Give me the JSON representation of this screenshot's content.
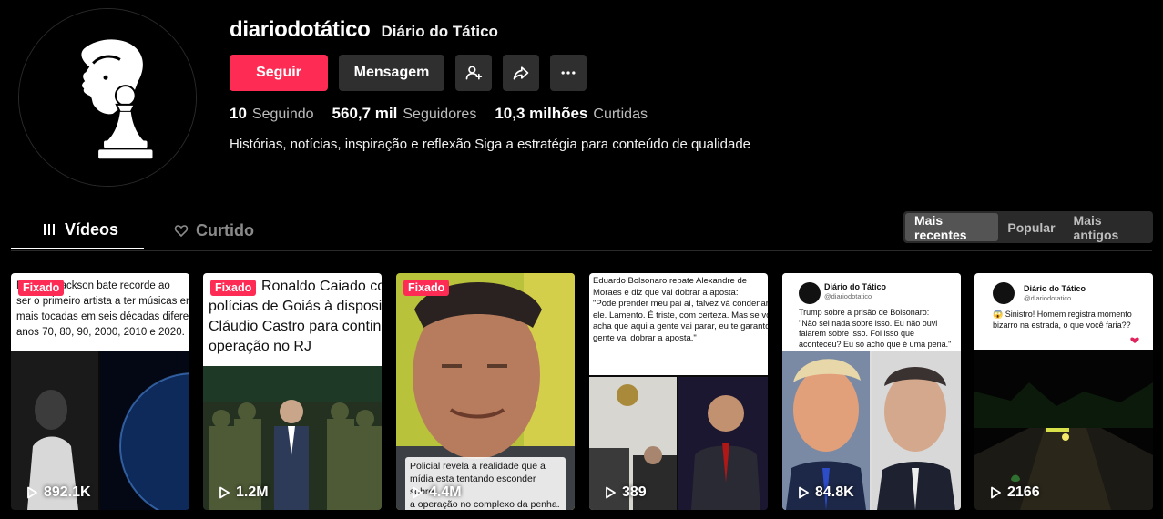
{
  "profile": {
    "username": "diariodotático",
    "nickname": "Diário do Tático",
    "bio": "Histórias, notícias, inspiração e reflexão Siga a estratégia para conteúdo de qualidade"
  },
  "actions": {
    "follow_label": "Seguir",
    "message_label": "Mensagem",
    "icons": [
      "add-friend-icon",
      "share-icon",
      "more-icon"
    ]
  },
  "stats": {
    "following": {
      "value": "10",
      "label": "Seguindo"
    },
    "followers": {
      "value": "560,7 mil",
      "label": "Seguidores"
    },
    "likes": {
      "value": "10,3 milhões",
      "label": "Curtidas"
    }
  },
  "tabs": {
    "videos": "Vídeos",
    "liked": "Curtido"
  },
  "sort": {
    "options": [
      "Mais recentes",
      "Popular",
      "Mais antigos"
    ],
    "selected": "Mais recentes"
  },
  "videos": [
    {
      "pinned": "Fixado",
      "views": "892.1K",
      "headline": [
        "Michael Jackson bate recorde ao",
        "ser o primeiro artista a ter músicas entre as",
        "mais tocadas em seis décadas diferentes: nos",
        "anos 70, 80, 90, 2000, 2010 e 2020."
      ]
    },
    {
      "pinned": "Fixado",
      "views": "1.2M",
      "headline": [
        "Ronaldo Caiado coloca",
        "polícias de Goiás à disposição de",
        "Cláudio Castro para continuar com",
        "operação no RJ"
      ]
    },
    {
      "pinned": "Fixado",
      "views": "4.4M",
      "caption": [
        "Policial revela a realidade que a",
        "mídia esta tentando esconder sobre",
        "a operação no complexo da penha."
      ]
    },
    {
      "pinned": "",
      "views": "389",
      "headline": [
        "Eduardo Bolsonaro rebate Alexandre de",
        "Moraes e diz que vai dobrar a aposta:",
        "",
        "\"Pode prender meu pai aí, talvez vá condenar",
        "ele. Lamento. É triste, com certeza. Mas se você",
        "acha que aqui a gente vai parar, eu te garanto: a",
        "gente vai dobrar a aposta.\""
      ]
    },
    {
      "pinned": "",
      "views": "84.8K",
      "post_name": "Diário do Tático",
      "post_handle": "@diariodotatico",
      "headline": [
        "Trump sobre a prisão de Bolsonaro:",
        "\"Não sei nada sobre isso. Eu não ouvi",
        "falarem sobre isso. Foi isso que",
        "aconteceu? Eu só acho que é uma pena.\""
      ]
    },
    {
      "pinned": "",
      "views": "2166",
      "post_name": "Diário do Tático",
      "post_handle": "@diariodotatico",
      "headline": [
        "😱 Sinistro! Homem registra momento",
        "bizarro na estrada, o que você faria??"
      ]
    }
  ],
  "colors": {
    "accent": "#fe2c55",
    "background": "#000000",
    "button_secondary": "#2f2f2f",
    "muted_text": "#bdbdbd"
  }
}
